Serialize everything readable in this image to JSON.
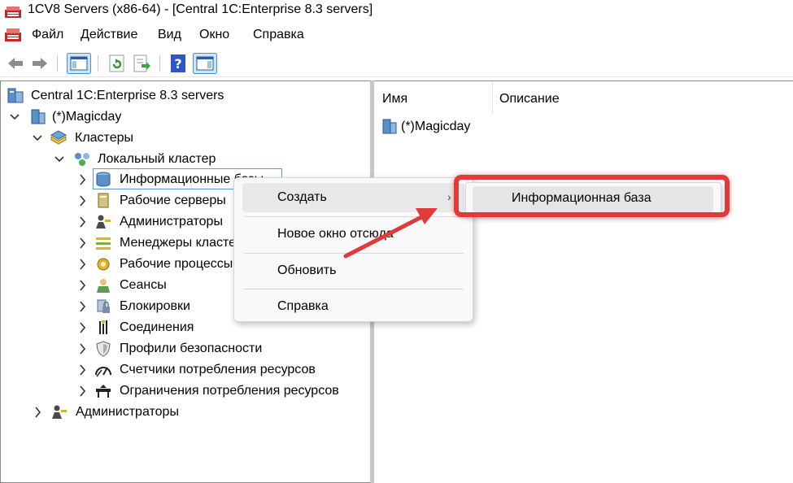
{
  "window": {
    "title": "1CV8 Servers (x86-64) - [Central 1C:Enterprise 8.3 servers]"
  },
  "menu": [
    "Файл",
    "Действие",
    "Вид",
    "Окно",
    "Справка"
  ],
  "toolbar": {
    "buttons": [
      "back-arrow-icon",
      "forward-arrow-icon",
      "console-tree-icon",
      "refresh-icon",
      "export-list-icon",
      "help-icon",
      "action-pane-icon"
    ]
  },
  "tree": {
    "root": "Central 1C:Enterprise 8.3 servers",
    "server": "(*)Magicday",
    "clusters": "Кластеры",
    "local_cluster": "Локальный кластер",
    "cluster_children": [
      "Информационные базы",
      "Рабочие серверы",
      "Администраторы",
      "Менеджеры кластера",
      "Рабочие процессы",
      "Сеансы",
      "Блокировки",
      "Соединения",
      "Профили безопасности",
      "Счетчики потребления ресурсов",
      "Ограничения потребления ресурсов"
    ],
    "server_admins": "Администраторы"
  },
  "list": {
    "columns": [
      "Имя",
      "Описание"
    ],
    "rows": [
      {
        "name": "(*)Magicday",
        "description": ""
      }
    ]
  },
  "context_menu": {
    "items": [
      "Создать",
      "Новое окно отсюда",
      "Обновить",
      "Справка"
    ]
  },
  "submenu": {
    "items": [
      "Информационная база"
    ]
  },
  "colors": {
    "highlight": "#e03a3a",
    "selection_border": "#5b9bd5",
    "menu_bg": "#f9f9f9"
  }
}
